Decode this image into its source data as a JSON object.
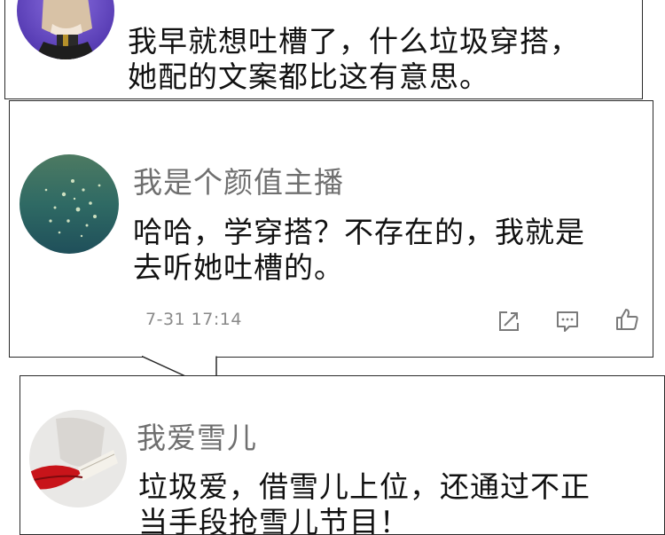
{
  "comments": [
    {
      "avatar": "dog-photo-avatar",
      "text_lines": [
        "我早就想吐槽了，什么垃圾穿搭，",
        "她配的文案都比这有意思。"
      ]
    },
    {
      "username": "我是个颜值主播",
      "avatar": "sparkling-water-avatar",
      "text_lines": [
        "哈哈，学穿搭？不存在的，我就是",
        "去听她吐槽的。"
      ],
      "timestamp": "7-31 17:14",
      "actions": [
        "share-icon",
        "reply-icon",
        "like-icon"
      ]
    },
    {
      "username": "我爱雪儿",
      "avatar": "red-lips-avatar",
      "text_lines": [
        "垃圾爱，借雪儿上位，还通过不正",
        "当手段抢雪儿节目！"
      ]
    }
  ],
  "colors": {
    "border": "#2a2a2a",
    "username": "#6f6f6f",
    "text": "#111111",
    "meta": "#8a8a8a",
    "icon": "#7a7a7a"
  }
}
